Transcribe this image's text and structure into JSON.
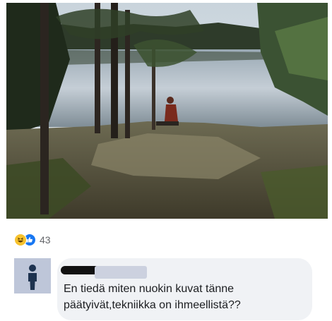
{
  "post": {
    "photo": {
      "alt": "",
      "icon": "lake-photo"
    },
    "reactions": {
      "icons": [
        "haha-icon",
        "like-icon"
      ],
      "count": "43"
    }
  },
  "comment": {
    "avatar_icon": "default-person-icon",
    "author_name_redacted": true,
    "text": "En tiedä miten nuokin kuvat tänne\npäätyivät,tekniikka on ihmeellistä??"
  },
  "colors": {
    "like_blue": "#1877f2",
    "haha_yellow": "#f7c22d",
    "bubble_bg": "#f0f2f5",
    "avatar_bg": "#bec6d9",
    "count_gray": "#65676b"
  }
}
